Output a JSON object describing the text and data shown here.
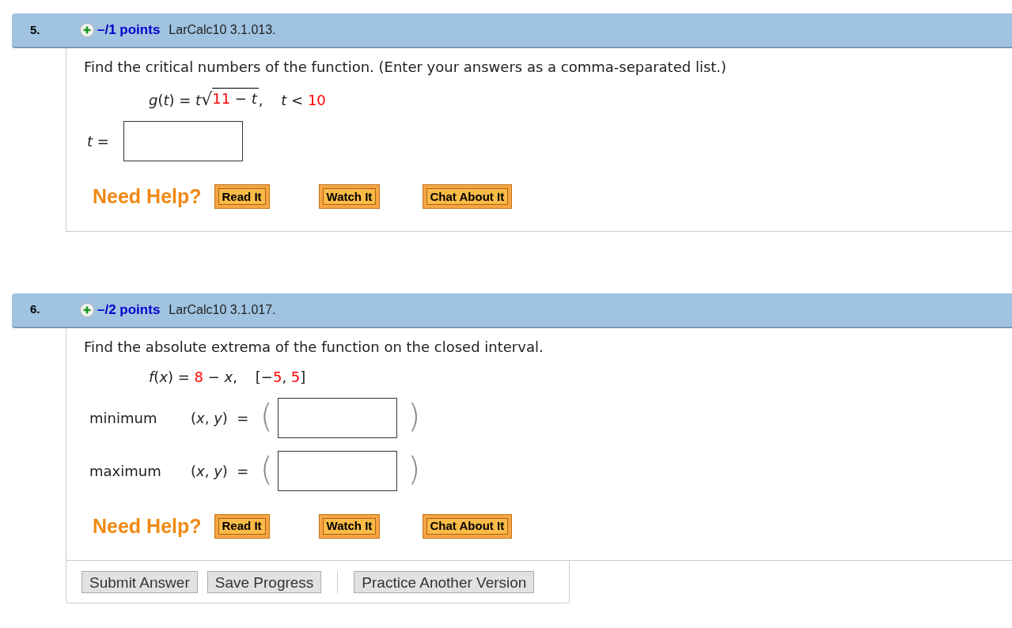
{
  "problems": [
    {
      "number": "5.",
      "points": "–/1 points",
      "source": "LarCalc10 3.1.013.",
      "prompt": "Find the critical numbers of the function. (Enter your answers as a comma-separated list.)",
      "formula": [
        {
          "kind": "var",
          "text": "g"
        },
        {
          "kind": "sym",
          "text": "("
        },
        {
          "kind": "var",
          "text": "t"
        },
        {
          "kind": "sym",
          "text": ") = "
        },
        {
          "kind": "var",
          "text": "t"
        },
        {
          "kind": "root",
          "sign": "√",
          "children": [
            {
              "kind": "given",
              "text": "11"
            },
            {
              "kind": "sym",
              "text": " − "
            },
            {
              "kind": "var",
              "text": "t"
            }
          ]
        },
        {
          "kind": "sym",
          "text": ",    "
        },
        {
          "kind": "var",
          "text": "t"
        },
        {
          "kind": "sym",
          "text": " < "
        },
        {
          "kind": "given",
          "text": "10"
        }
      ],
      "answers": [
        {
          "formula": [
            {
              "kind": "var",
              "text": "t"
            },
            {
              "kind": "sym",
              "text": " ="
            }
          ]
        }
      ],
      "help": {
        "label": "Need Help?",
        "buttons": [
          "Read It",
          "Watch It",
          "Chat About It"
        ]
      }
    },
    {
      "number": "6.",
      "points": "–/2 points",
      "source": "LarCalc10 3.1.017.",
      "prompt": "Find the absolute extrema of the function on the closed interval.",
      "formula": [
        {
          "kind": "var",
          "text": "f"
        },
        {
          "kind": "sym",
          "text": "("
        },
        {
          "kind": "var",
          "text": "x"
        },
        {
          "kind": "sym",
          "text": ") = "
        },
        {
          "kind": "given",
          "text": "8"
        },
        {
          "kind": "sym",
          "text": " − "
        },
        {
          "kind": "var",
          "text": "x"
        },
        {
          "kind": "sym",
          "text": ",    [−"
        },
        {
          "kind": "given",
          "text": "5"
        },
        {
          "kind": "sym",
          "text": ", "
        },
        {
          "kind": "given",
          "text": "5"
        },
        {
          "kind": "sym",
          "text": "]"
        }
      ],
      "answers": [
        {
          "label": "minimum",
          "formula": [
            {
              "kind": "sym",
              "text": "("
            },
            {
              "kind": "var",
              "text": "x"
            },
            {
              "kind": "sym",
              "text": ", "
            },
            {
              "kind": "var",
              "text": "y"
            },
            {
              "kind": "sym",
              "text": ")  ="
            }
          ],
          "brackets": [
            "(",
            ")"
          ]
        },
        {
          "label": "maximum",
          "formula": [
            {
              "kind": "sym",
              "text": "("
            },
            {
              "kind": "var",
              "text": "x"
            },
            {
              "kind": "sym",
              "text": ", "
            },
            {
              "kind": "var",
              "text": "y"
            },
            {
              "kind": "sym",
              "text": ")  ="
            }
          ],
          "brackets": [
            "(",
            ")"
          ]
        }
      ],
      "help": {
        "label": "Need Help?",
        "buttons": [
          "Read It",
          "Watch It",
          "Chat About It"
        ]
      }
    }
  ],
  "footer": {
    "buttons": [
      "Submit Answer",
      "Save Progress"
    ],
    "extra_buttons": [
      "Practice Another Version"
    ]
  }
}
